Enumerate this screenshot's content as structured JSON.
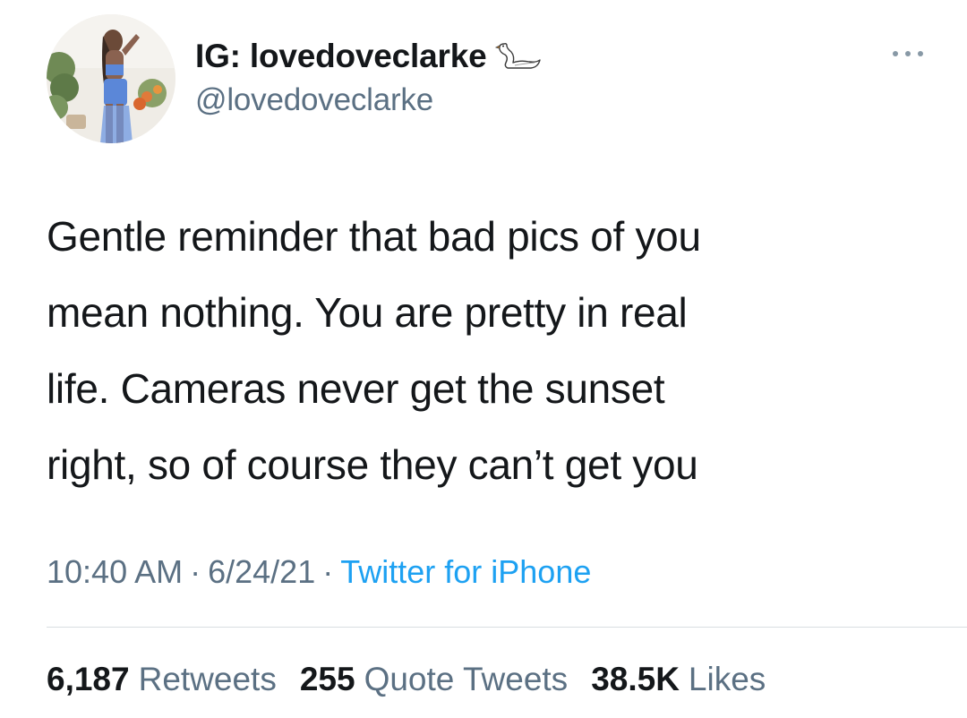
{
  "user": {
    "display_name": "IG: lovedoveclarke",
    "handle": "@lovedoveclarke",
    "badge_icon": "swan-icon",
    "avatar_icon": "profile-photo"
  },
  "menu_icon": "more-options-icon",
  "tweet": {
    "lines": [
      "Gentle reminder that bad pics of you",
      "mean nothing. You are pretty in real",
      "life. Cameras never get the sunset",
      "right, so of course they can’t get you"
    ]
  },
  "meta": {
    "time": "10:40 AM",
    "separator": "·",
    "date": "6/24/21",
    "source": "Twitter for iPhone"
  },
  "stats": {
    "retweets_count": "6,187",
    "retweets_label": "Retweets",
    "quotes_count": "255",
    "quotes_label": "Quote Tweets",
    "likes_count": "38.5K",
    "likes_label": "Likes"
  },
  "colors": {
    "text_primary": "#14171a",
    "text_secondary": "#5b7083",
    "link": "#1da1f2",
    "divider": "#d8dde2"
  }
}
